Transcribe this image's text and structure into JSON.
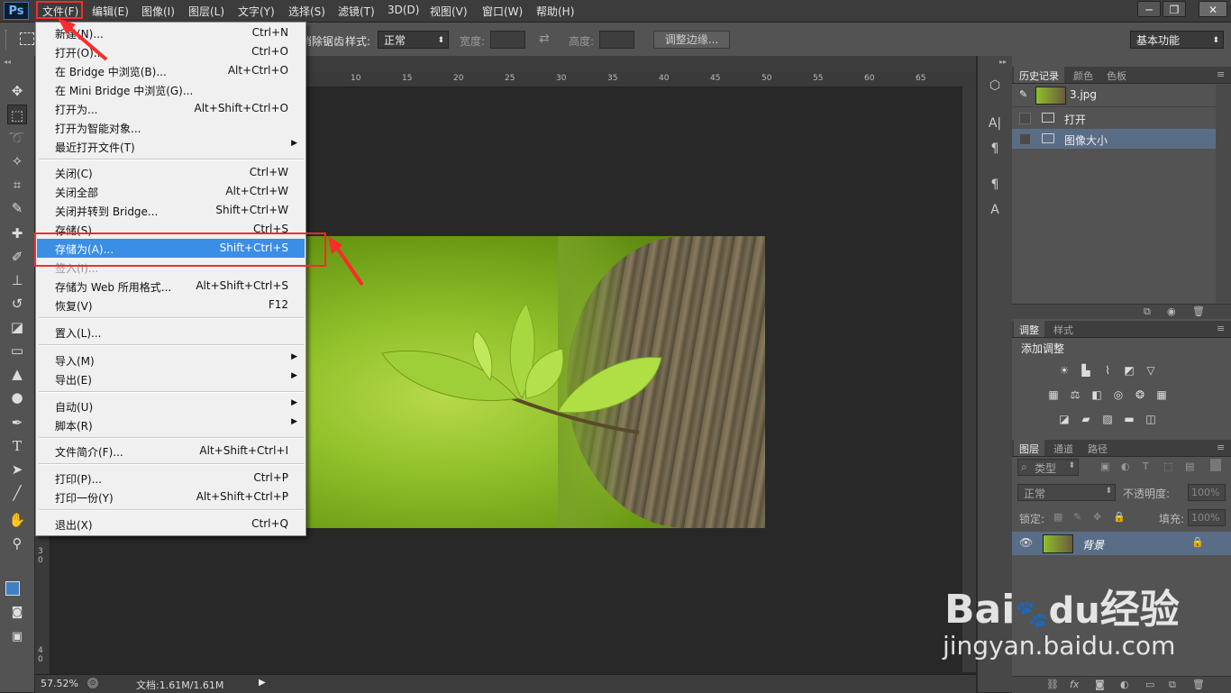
{
  "app": {
    "logo": "Ps",
    "menus": [
      "文件(F)",
      "编辑(E)",
      "图像(I)",
      "图层(L)",
      "文字(Y)",
      "选择(S)",
      "滤镜(T)",
      "3D(D)",
      "视图(V)",
      "窗口(W)",
      "帮助(H)"
    ],
    "window_controls": [
      "─",
      "❐",
      "✕"
    ]
  },
  "options_bar": {
    "feather_suffix": "消除锯齿",
    "style_label": "样式:",
    "style_value": "正常",
    "width_label": "宽度:",
    "height_label": "高度:",
    "refine_edge": "调整边缘...",
    "workspace": "基本功能"
  },
  "ruler": {
    "top_ticks": [
      "10",
      "15",
      "20",
      "25",
      "30",
      "35",
      "40",
      "45",
      "50",
      "55",
      "60",
      "65"
    ],
    "left_ticks": [
      "3",
      "0",
      "4",
      "0"
    ]
  },
  "file_menu": {
    "items": [
      {
        "label": "新建(N)...",
        "shortcut": "Ctrl+N"
      },
      {
        "label": "打开(O)...",
        "shortcut": "Ctrl+O"
      },
      {
        "label": "在 Bridge 中浏览(B)...",
        "shortcut": "Alt+Ctrl+O"
      },
      {
        "label": "在 Mini Bridge 中浏览(G)...",
        "shortcut": ""
      },
      {
        "label": "打开为...",
        "shortcut": "Alt+Shift+Ctrl+O"
      },
      {
        "label": "打开为智能对象...",
        "shortcut": ""
      },
      {
        "label": "最近打开文件(T)",
        "shortcut": ""
      },
      {
        "label": "关闭(C)",
        "shortcut": "Ctrl+W"
      },
      {
        "label": "关闭全部",
        "shortcut": "Alt+Ctrl+W"
      },
      {
        "label": "关闭并转到 Bridge...",
        "shortcut": "Shift+Ctrl+W"
      },
      {
        "label": "存储(S)",
        "shortcut": "Ctrl+S"
      },
      {
        "label": "存储为(A)...",
        "shortcut": "Shift+Ctrl+S"
      },
      {
        "label": "签入(I)...",
        "shortcut": ""
      },
      {
        "label": "存储为 Web 所用格式...",
        "shortcut": "Alt+Shift+Ctrl+S"
      },
      {
        "label": "恢复(V)",
        "shortcut": "F12"
      },
      {
        "label": "置入(L)...",
        "shortcut": ""
      },
      {
        "label": "导入(M)",
        "shortcut": ""
      },
      {
        "label": "导出(E)",
        "shortcut": ""
      },
      {
        "label": "自动(U)",
        "shortcut": ""
      },
      {
        "label": "脚本(R)",
        "shortcut": ""
      },
      {
        "label": "文件简介(F)...",
        "shortcut": "Alt+Shift+Ctrl+I"
      },
      {
        "label": "打印(P)...",
        "shortcut": "Ctrl+P"
      },
      {
        "label": "打印一份(Y)",
        "shortcut": "Alt+Shift+Ctrl+P"
      },
      {
        "label": "退出(X)",
        "shortcut": "Ctrl+Q"
      }
    ]
  },
  "history_panel": {
    "tabs": [
      "历史记录",
      "颜色",
      "色板"
    ],
    "snapshot": "3.jpg",
    "steps": [
      "打开",
      "图像大小"
    ]
  },
  "adjustments_panel": {
    "tabs": [
      "调整",
      "样式"
    ],
    "title": "添加调整"
  },
  "layers_panel": {
    "tabs": [
      "图层",
      "通道",
      "路径"
    ],
    "filter_kind": "类型",
    "blend_mode": "正常",
    "opacity_label": "不透明度:",
    "opacity_value": "100%",
    "lock_label": "锁定:",
    "fill_label": "填充:",
    "fill_value": "100%",
    "layer_name": "背景"
  },
  "status_bar": {
    "zoom": "57.52%",
    "doc_info": "文档:1.61M/1.61M"
  },
  "watermark": {
    "brand": "Bai",
    "brand_suffix": "经验",
    "url": "jingyan.baidu.com"
  },
  "colors": {
    "highlight": "#3a8ee6",
    "annotation": "#ff2a2a",
    "foreground": "#3f7fc4"
  }
}
